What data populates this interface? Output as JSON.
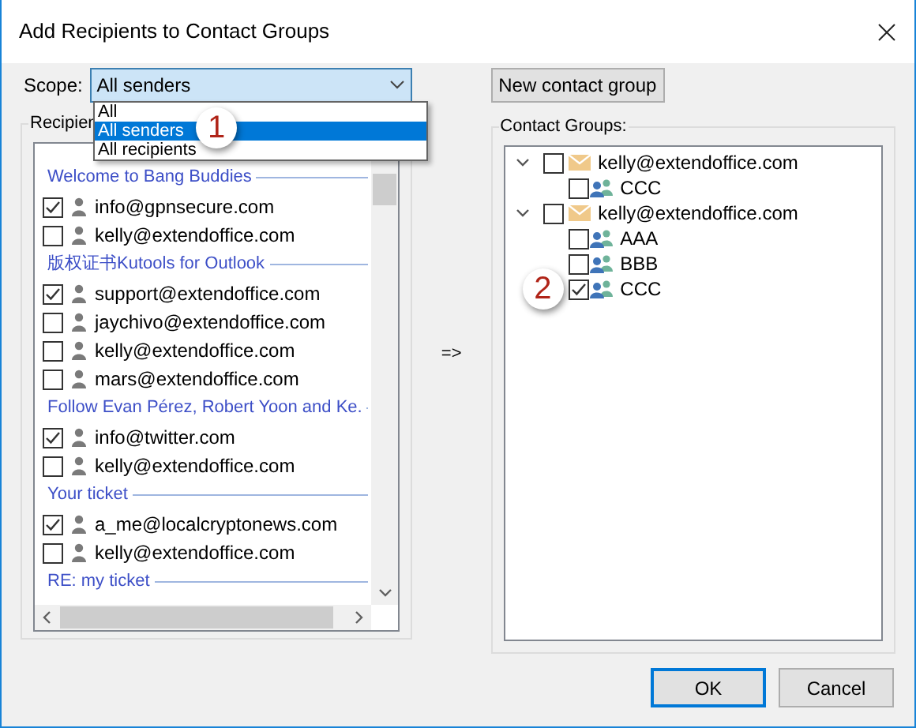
{
  "window": {
    "title": "Add Recipients to Contact Groups"
  },
  "scope": {
    "label": "Scope:",
    "value": "All senders",
    "marker": "1",
    "options": [
      {
        "label": "All",
        "selected": false
      },
      {
        "label": "All senders",
        "selected": true
      },
      {
        "label": "All recipients",
        "selected": false
      }
    ]
  },
  "recipients": {
    "label": "Recipien",
    "sections": [
      {
        "title": "Welcome to Bang Buddies",
        "entries": [
          {
            "email": "info@gpnsecure.com",
            "checked": true
          },
          {
            "email": "kelly@extendoffice.com",
            "checked": false
          }
        ]
      },
      {
        "title": "版权证书Kutools for Outlook",
        "entries": [
          {
            "email": "support@extendoffice.com",
            "checked": true
          },
          {
            "email": "jaychivo@extendoffice.com",
            "checked": false
          },
          {
            "email": "kelly@extendoffice.com",
            "checked": false
          },
          {
            "email": "mars@extendoffice.com",
            "checked": false
          }
        ]
      },
      {
        "title": "Follow Evan Pérez, Robert Yoon and Ke.",
        "entries": [
          {
            "email": "info@twitter.com",
            "checked": true
          },
          {
            "email": "kelly@extendoffice.com",
            "checked": false
          }
        ]
      },
      {
        "title": "Your ticket",
        "entries": [
          {
            "email": "a_me@localcryptonews.com",
            "checked": true
          },
          {
            "email": "kelly@extendoffice.com",
            "checked": false
          }
        ]
      },
      {
        "title": "RE: my ticket"
      }
    ]
  },
  "arrow": "=>",
  "new_group_button": "New contact group",
  "contact_groups": {
    "label": "Contact Groups:",
    "accounts": [
      {
        "name": "kelly@extendoffice.com",
        "checked": false,
        "expanded": true,
        "children": [
          {
            "name": "CCC",
            "checked": false
          }
        ]
      },
      {
        "name": "kelly@extendoffice.com",
        "checked": false,
        "expanded": true,
        "children": [
          {
            "name": "AAA",
            "checked": false
          },
          {
            "name": "BBB",
            "checked": false
          },
          {
            "name": "CCC",
            "checked": true,
            "marker": "2"
          }
        ]
      }
    ]
  },
  "buttons": [
    {
      "label": "OK",
      "kind": "default"
    },
    {
      "label": "Cancel",
      "kind": "normal"
    }
  ]
}
